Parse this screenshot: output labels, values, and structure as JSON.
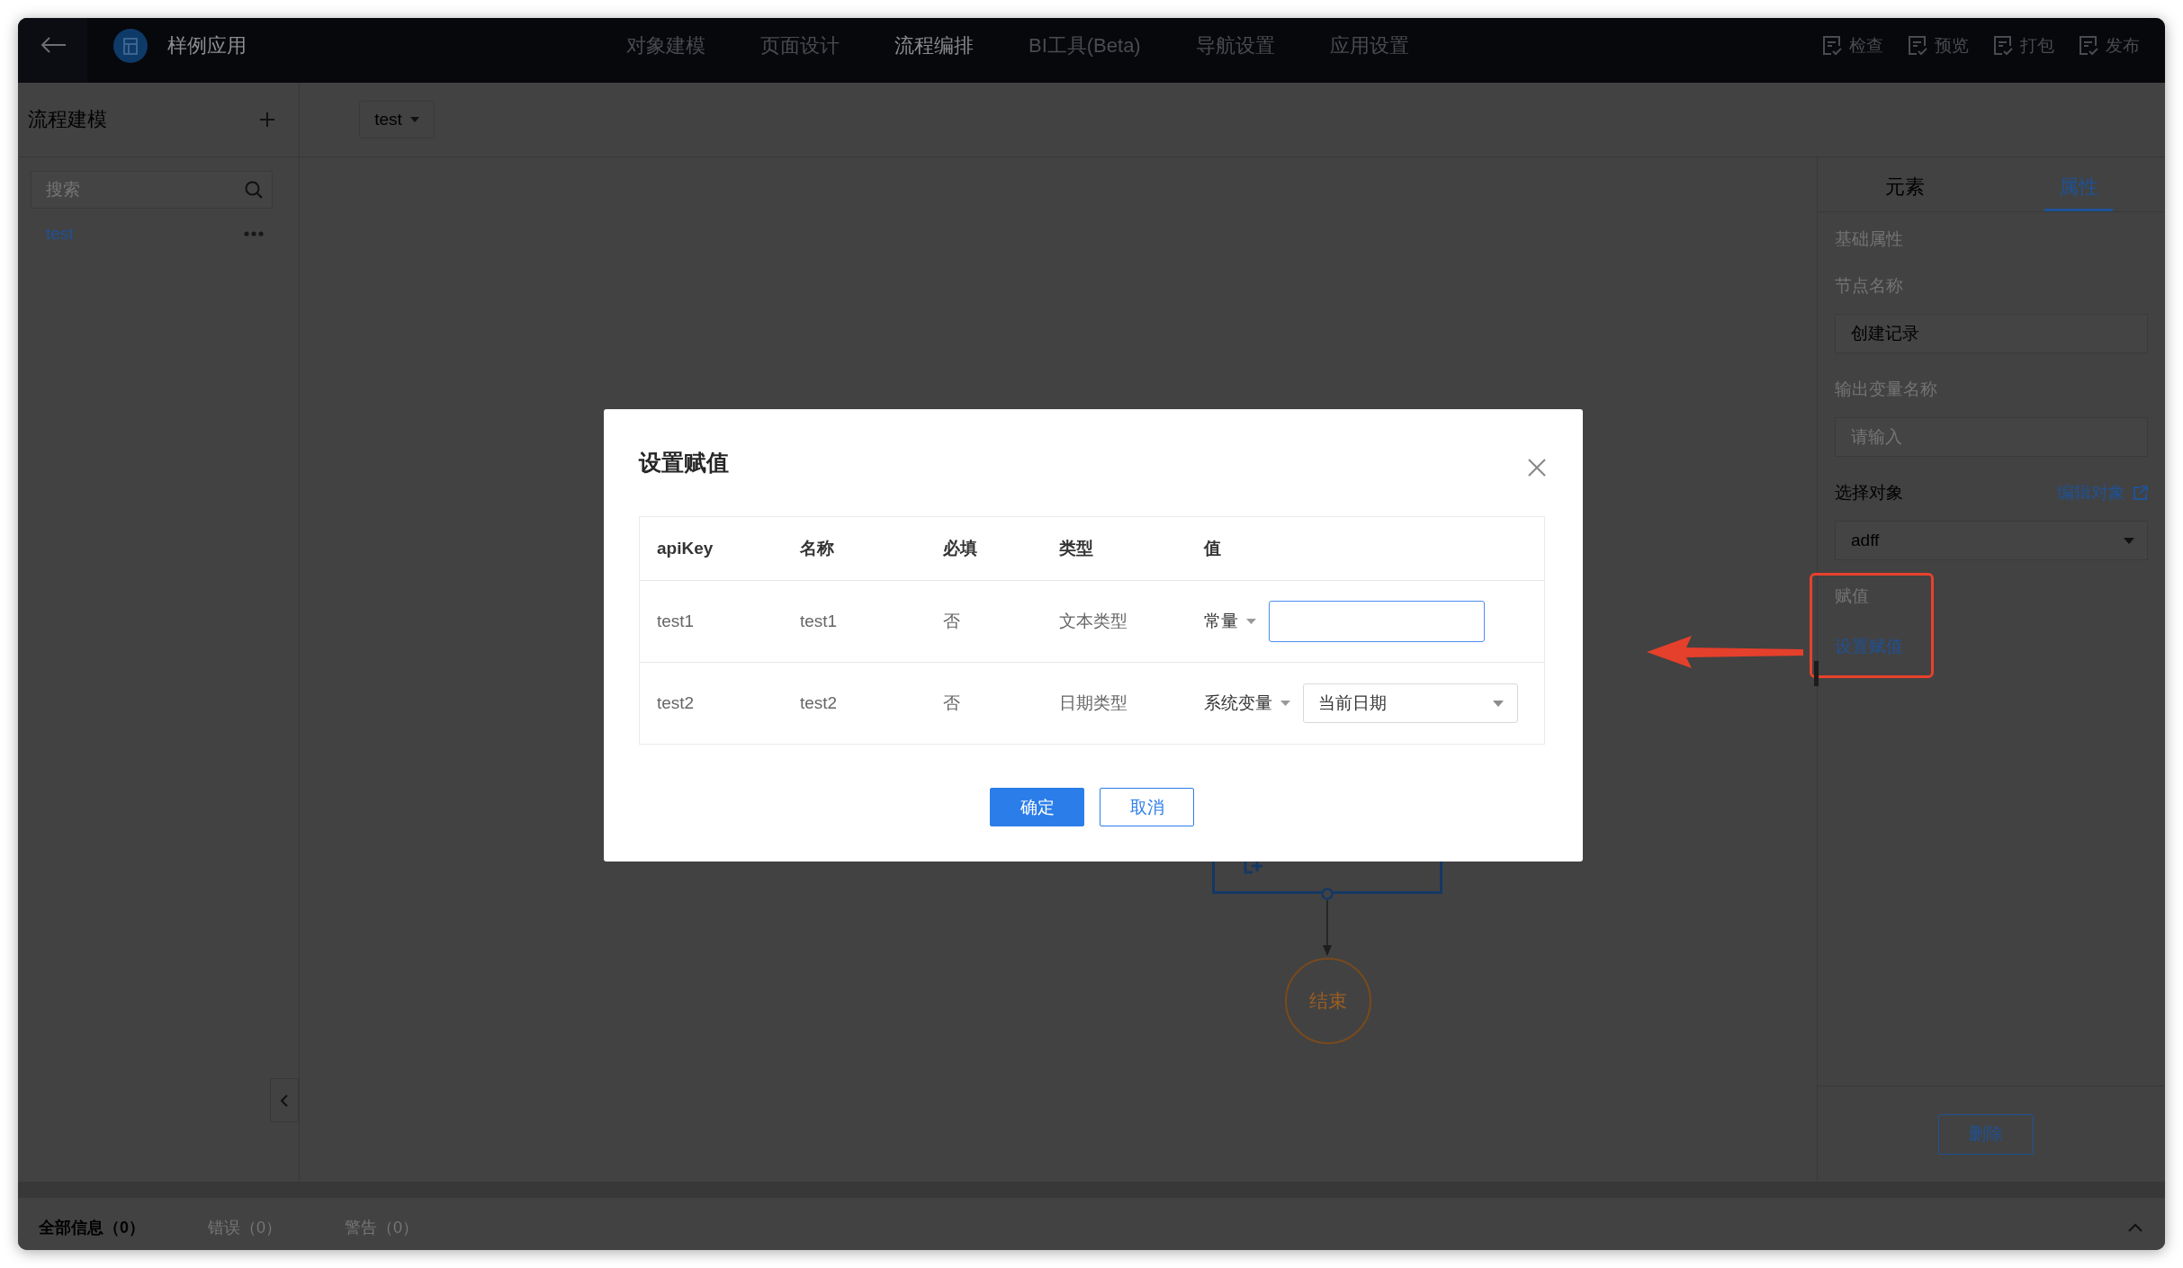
{
  "top_bar": {
    "app_name": "样例应用",
    "nav": [
      {
        "label": "对象建模",
        "selected": false
      },
      {
        "label": "页面设计",
        "selected": false
      },
      {
        "label": "流程编排",
        "selected": true
      },
      {
        "label": "BI工具(Beta)",
        "selected": false
      },
      {
        "label": "导航设置",
        "selected": false
      },
      {
        "label": "应用设置",
        "selected": false
      }
    ],
    "actions": [
      "检查",
      "预览",
      "打包",
      "发布"
    ]
  },
  "sidebar": {
    "title": "流程建模",
    "search": {
      "placeholder": "搜索"
    },
    "items": [
      {
        "label": "test",
        "selected": true
      }
    ]
  },
  "canvas": {
    "flow_selector": "test",
    "nodes": [
      {
        "kind": "task"
      },
      {
        "kind": "end",
        "label": "结束"
      }
    ]
  },
  "right_panel": {
    "tabs": [
      {
        "label": "元素",
        "selected": false
      },
      {
        "label": "属性",
        "selected": true
      }
    ],
    "section_title": "基础属性",
    "fields": [
      {
        "kind": "input",
        "label": "节点名称",
        "value": "创建记录"
      },
      {
        "kind": "input",
        "label": "输出变量名称",
        "placeholder": "请输入"
      },
      {
        "kind": "select",
        "label": "选择对象",
        "link": "编辑对象",
        "value": "adff"
      },
      {
        "kind": "link",
        "label": "赋值",
        "link": "设置赋值",
        "highlighted": true
      }
    ],
    "delete_button": "删除"
  },
  "bottom_bar": {
    "tabs": [
      {
        "label": "全部信息（0）",
        "selected": true
      },
      {
        "label": "错误（0）",
        "selected": false
      },
      {
        "label": "警告（0）",
        "selected": false
      }
    ]
  },
  "dialog": {
    "title": "设置赋值",
    "columns": [
      "apiKey",
      "名称",
      "必填",
      "类型",
      "值"
    ],
    "rows": [
      {
        "cells": [
          "test1",
          "test1",
          "否",
          "文本类型"
        ],
        "source": "常量",
        "kind": "input"
      },
      {
        "cells": [
          "test2",
          "test2",
          "否",
          "日期类型"
        ],
        "source": "系统变量",
        "kind": "select",
        "value": "当前日期"
      }
    ],
    "buttons": [
      {
        "label": "确定",
        "kind": "primary"
      },
      {
        "label": "取消",
        "kind": "default"
      }
    ]
  }
}
